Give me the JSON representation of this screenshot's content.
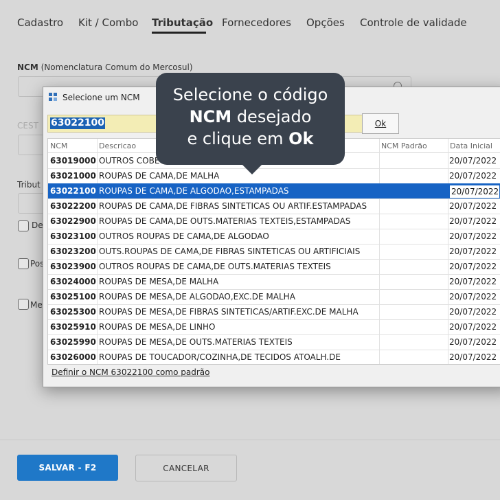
{
  "tabs": [
    {
      "label": "Cadastro"
    },
    {
      "label": "Kit / Combo"
    },
    {
      "label": "Tributação"
    },
    {
      "label": "Fornecedores"
    },
    {
      "label": "Opções"
    },
    {
      "label": "Controle de validade"
    }
  ],
  "form": {
    "ncm_label_bold": "NCM",
    "ncm_label_rest": "(Nomenclatura Comum do Mercosul)",
    "cest_label": "CEST",
    "tribut_label": "Tribut",
    "check1_label": "De",
    "check2_label": "Pos",
    "check3_label": "Me"
  },
  "dialog": {
    "title": "Selecione um NCM",
    "search_value": "63022100",
    "ok_label": "Ok",
    "columns": [
      "NCM",
      "Descricao",
      "NCM Padrão",
      "Data Inicial"
    ],
    "rows": [
      {
        "ncm": "63019000",
        "desc": "OUTROS COBE",
        "date": "20/07/2022"
      },
      {
        "ncm": "63021000",
        "desc": "ROUPAS DE CAMA,DE MALHA",
        "date": "20/07/2022"
      },
      {
        "ncm": "63022100",
        "desc": "ROUPAS DE CAMA,DE ALGODAO,ESTAMPADAS",
        "date": "20/07/2022"
      },
      {
        "ncm": "63022200",
        "desc": "ROUPAS DE CAMA,DE FIBRAS SINTETICAS OU ARTIF.ESTAMPADAS",
        "date": "20/07/2022"
      },
      {
        "ncm": "63022900",
        "desc": "ROUPAS DE CAMA,DE OUTS.MATERIAS TEXTEIS,ESTAMPADAS",
        "date": "20/07/2022"
      },
      {
        "ncm": "63023100",
        "desc": "OUTROS ROUPAS DE CAMA,DE ALGODAO",
        "date": "20/07/2022"
      },
      {
        "ncm": "63023200",
        "desc": "OUTS.ROUPAS DE CAMA,DE FIBRAS SINTETICAS OU ARTIFICIAIS",
        "date": "20/07/2022"
      },
      {
        "ncm": "63023900",
        "desc": "OUTROS ROUPAS DE CAMA,DE OUTS.MATERIAS TEXTEIS",
        "date": "20/07/2022"
      },
      {
        "ncm": "63024000",
        "desc": "ROUPAS DE MESA,DE MALHA",
        "date": "20/07/2022"
      },
      {
        "ncm": "63025100",
        "desc": "ROUPAS DE MESA,DE ALGODAO,EXC.DE MALHA",
        "date": "20/07/2022"
      },
      {
        "ncm": "63025300",
        "desc": "ROUPAS DE MESA,DE FIBRAS SINTETICAS/ARTIF.EXC.DE MALHA",
        "date": "20/07/2022"
      },
      {
        "ncm": "63025910",
        "desc": "ROUPAS DE MESA,DE LINHO",
        "date": "20/07/2022"
      },
      {
        "ncm": "63025990",
        "desc": "ROUPAS DE MESA,DE OUTS.MATERIAS TEXTEIS",
        "date": "20/07/2022"
      },
      {
        "ncm": "63026000",
        "desc": "ROUPAS DE TOUCADOR/COZINHA,DE TECIDOS ATOALH.DE",
        "date": "20/07/2022"
      }
    ],
    "selected_index": 2,
    "footer_link": "Definir o NCM 63022100 como padrão"
  },
  "callout": {
    "line1": "Selecione o código",
    "line2_bold": "NCM",
    "line2_rest": " desejado",
    "line3_rest": "e clique em ",
    "line3_bold": "Ok"
  },
  "buttons": {
    "save": "SALVAR - F2",
    "cancel": "CANCELAR"
  },
  "colors": {
    "primary": "#1f78c8",
    "selection": "#1763c4",
    "callout_bg": "#3a424d",
    "search_bg": "#f3edb5"
  }
}
